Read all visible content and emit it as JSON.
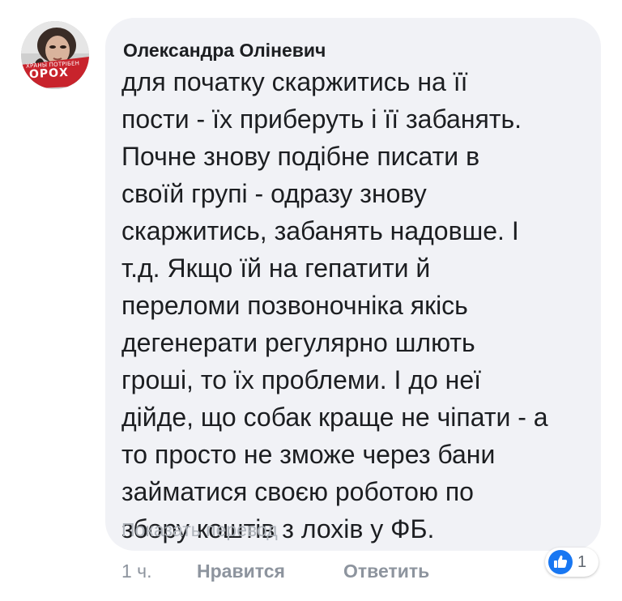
{
  "comment": {
    "author": "Олександра Оліневич",
    "text": "для початку скаржитись на її\nпости - їх приберуть і її забанять.\nПочне знову подібне писати в\nсвоїй групі - одразу знову\nскаржитись, забанять надовше. І\nт.д. Якщо їй на гепатити й\nпереломи позвоночніка якісь\nдегенерати регулярно шлють\nгроші, то їх проблеми. І до неї\nдійде, що собак краще не чіпати - а\nто просто не зможе через бани\nзайматися своєю роботою по\nзбору коштів з лохів  у ФБ.",
    "translate_link": "Показать перевод"
  },
  "avatar": {
    "logo_top_text": "ХРАНЫ ПОТРІБЕН",
    "logo_main_text": "ОРОХ"
  },
  "actions": {
    "time": "1 ч.",
    "like": "Нравится",
    "reply": "Ответить"
  },
  "reactions": {
    "icon": "like-thumb-icon",
    "count": "1",
    "color": "#1877f2"
  }
}
